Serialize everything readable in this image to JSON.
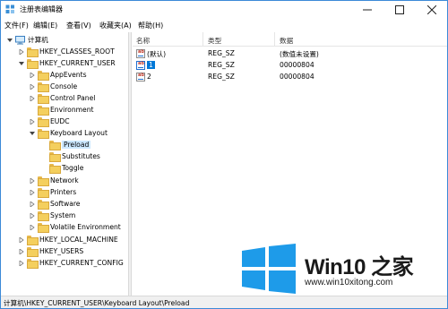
{
  "window": {
    "title": "注册表编辑器",
    "controls": {
      "minimize": "minimize-icon",
      "maximize": "maximize-icon",
      "close": "close-icon"
    }
  },
  "menu": [
    "文件(F)",
    "编辑(E)",
    "查看(V)",
    "收藏夹(A)",
    "帮助(H)"
  ],
  "tree": {
    "root": "计算机",
    "hives": [
      {
        "label": "HKEY_CLASSES_ROOT"
      },
      {
        "label": "HKEY_CURRENT_USER"
      },
      {
        "label": "HKEY_LOCAL_MACHINE"
      },
      {
        "label": "HKEY_USERS"
      },
      {
        "label": "HKEY_CURRENT_CONFIG"
      }
    ],
    "hkcu_children": [
      "AppEvents",
      "Console",
      "Control Panel",
      "Environment",
      "EUDC",
      "Keyboard Layout",
      "Network",
      "Printers",
      "Software",
      "System",
      "Volatile Environment"
    ],
    "keyboard_layout_children": [
      "Preload",
      "Substitutes",
      "Toggle"
    ],
    "selected": "Preload"
  },
  "list": {
    "columns": [
      "名称",
      "类型",
      "数据"
    ],
    "rows": [
      {
        "name": "(默认)",
        "type": "REG_SZ",
        "data": "(数值未设置)"
      },
      {
        "name": "1",
        "type": "REG_SZ",
        "data": "00000804"
      },
      {
        "name": "2",
        "type": "REG_SZ",
        "data": "00000804"
      }
    ]
  },
  "status": "计算机\\HKEY_CURRENT_USER\\Keyboard Layout\\Preload",
  "watermark": {
    "title": "Win10 之家",
    "url": "www.win10xitong.com",
    "colors": {
      "logo": "#1e9be9"
    }
  }
}
